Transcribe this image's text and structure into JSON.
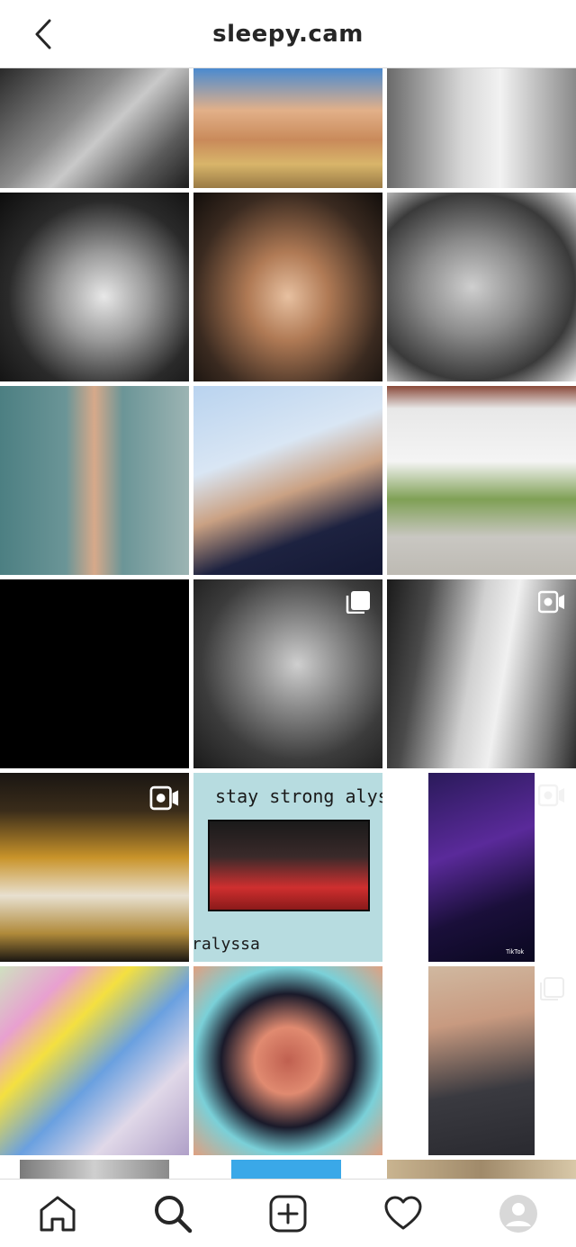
{
  "header": {
    "title": "sleepy.cam"
  },
  "grid": {
    "posts": [
      {
        "id": "post-1",
        "type": "photo"
      },
      {
        "id": "post-2",
        "type": "photo"
      },
      {
        "id": "post-3",
        "type": "photo"
      },
      {
        "id": "post-4",
        "type": "photo"
      },
      {
        "id": "post-5",
        "type": "photo"
      },
      {
        "id": "post-6",
        "type": "photo"
      },
      {
        "id": "post-7",
        "type": "photo"
      },
      {
        "id": "post-8",
        "type": "photo"
      },
      {
        "id": "post-9",
        "type": "photo"
      },
      {
        "id": "post-10",
        "type": "photo"
      },
      {
        "id": "post-11",
        "type": "carousel"
      },
      {
        "id": "post-12",
        "type": "igtv"
      },
      {
        "id": "post-13",
        "type": "igtv"
      },
      {
        "id": "post-14",
        "type": "photo",
        "text_top": "stay strong alys",
        "text_bottom": "ralyssa"
      },
      {
        "id": "post-15",
        "type": "igtv",
        "watermark": "TikTok"
      },
      {
        "id": "post-16",
        "type": "photo"
      },
      {
        "id": "post-17",
        "type": "photo"
      },
      {
        "id": "post-18",
        "type": "carousel"
      }
    ]
  },
  "nav": {
    "items": [
      {
        "name": "home",
        "icon": "home-icon"
      },
      {
        "name": "search",
        "icon": "search-icon"
      },
      {
        "name": "new-post",
        "icon": "add-square-icon"
      },
      {
        "name": "activity",
        "icon": "heart-icon"
      },
      {
        "name": "profile",
        "icon": "avatar-icon"
      }
    ]
  },
  "colors": {
    "text": "#262626",
    "border": "#dbdbdb",
    "background": "#ffffff"
  }
}
